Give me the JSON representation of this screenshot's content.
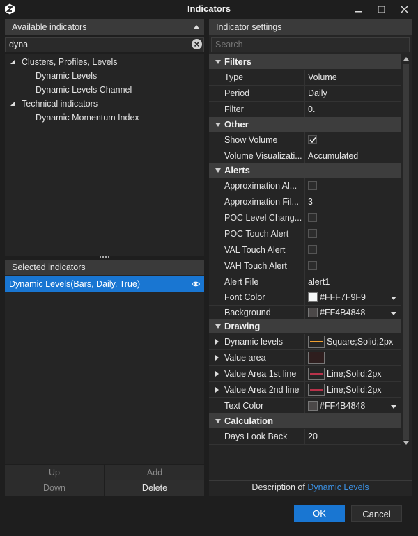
{
  "window": {
    "title": "Indicators",
    "logo_icon": "app-logo-icon",
    "controls": [
      "minimize-icon",
      "maximize-icon",
      "close-icon"
    ]
  },
  "left": {
    "available_header": "Available indicators",
    "filter_value": "dyna",
    "tree": [
      {
        "label": "Clusters, Profiles, Levels",
        "expanded": true,
        "level": 0
      },
      {
        "label": "Dynamic Levels",
        "level": 1
      },
      {
        "label": "Dynamic Levels Channel",
        "level": 1
      },
      {
        "label": "Technical indicators",
        "expanded": true,
        "level": 0
      },
      {
        "label": "Dynamic Momentum Index",
        "level": 1
      }
    ],
    "selected_header": "Selected indicators",
    "selected_items": [
      {
        "label": "Dynamic Levels(Bars, Daily, True)",
        "icon": "eye-icon"
      }
    ],
    "buttons": {
      "up": "Up",
      "add": "Add",
      "down": "Down",
      "delete": "Delete"
    }
  },
  "right": {
    "header": "Indicator settings",
    "search_placeholder": "Search",
    "categories": {
      "filters": "Filters",
      "other": "Other",
      "alerts": "Alerts",
      "drawing": "Drawing",
      "calculation": "Calculation"
    },
    "filters": {
      "type": {
        "name": "Type",
        "value": "Volume"
      },
      "period": {
        "name": "Period",
        "value": "Daily"
      },
      "filter": {
        "name": "Filter",
        "value": "0."
      }
    },
    "other": {
      "show_volume": {
        "name": "Show Volume",
        "checked": true
      },
      "volume_vis": {
        "name": "Volume Visualizati...",
        "value": "Accumulated"
      }
    },
    "alerts": {
      "approx_al": {
        "name": "Approximation Al...",
        "checked": false
      },
      "approx_fil": {
        "name": "Approximation Fil...",
        "value": "3"
      },
      "poc_change": {
        "name": "POC Level Chang...",
        "checked": false
      },
      "poc_touch": {
        "name": "POC Touch Alert",
        "checked": false
      },
      "val_touch": {
        "name": "VAL Touch Alert",
        "checked": false
      },
      "vah_touch": {
        "name": "VAH Touch Alert",
        "checked": false
      },
      "alert_file": {
        "name": "Alert File",
        "value": "alert1"
      },
      "font_color": {
        "name": "Font Color",
        "value": "#FFF7F9F9",
        "swatch": "#F7F9F9"
      },
      "background": {
        "name": "Background",
        "value": "#FF4B4848",
        "swatch": "#4B4848"
      }
    },
    "drawing": {
      "dynamic_levels": {
        "name": "Dynamic levels",
        "value": "Square;Solid;2px",
        "line_color": "#f0a030"
      },
      "value_area": {
        "name": "Value area",
        "value": "",
        "line_color": "#5a2a2a"
      },
      "va_1st": {
        "name": "Value Area 1st line",
        "value": "Line;Solid;2px",
        "line_color": "#b8324a"
      },
      "va_2nd": {
        "name": "Value Area 2nd line",
        "value": "Line;Solid;2px",
        "line_color": "#b8324a"
      },
      "text_color": {
        "name": "Text Color",
        "value": "#FF4B4848",
        "swatch": "#4B4848"
      }
    },
    "calculation": {
      "days_look_back": {
        "name": "Days Look Back",
        "value": "20"
      }
    },
    "description_prefix": "Description of",
    "description_link": "Dynamic Levels"
  },
  "dialog_buttons": {
    "ok": "OK",
    "cancel": "Cancel"
  }
}
